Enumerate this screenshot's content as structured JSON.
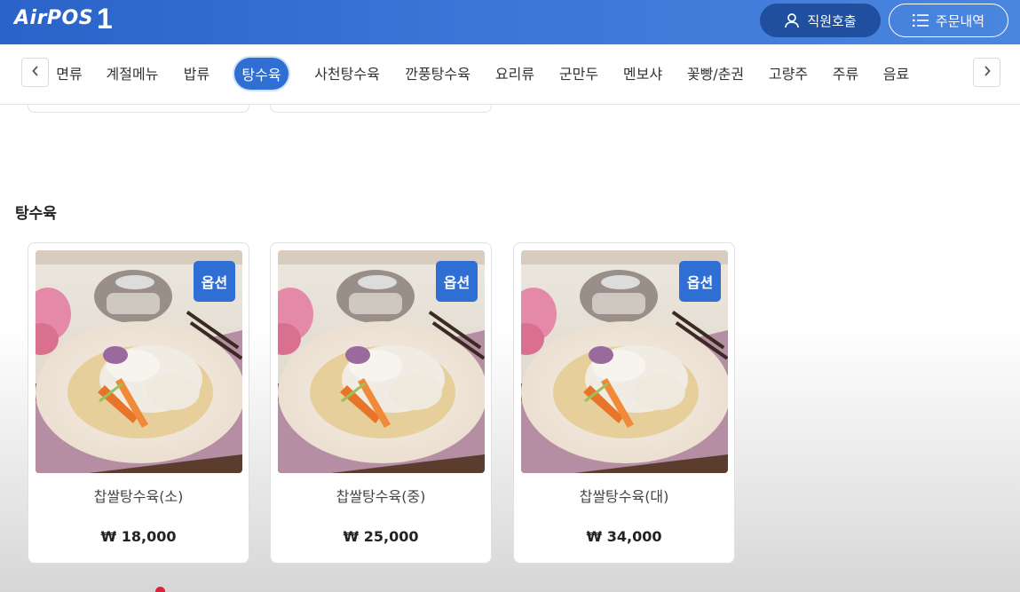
{
  "header": {
    "logo": "AirPOS",
    "table_number": "1",
    "staff_call_label": "직원호출",
    "order_history_label": "주문내역"
  },
  "categories": [
    {
      "label": "면류",
      "active": false
    },
    {
      "label": "계절메뉴",
      "active": false
    },
    {
      "label": "밥류",
      "active": false
    },
    {
      "label": "탕수육",
      "active": true
    },
    {
      "label": "사천탕수육",
      "active": false
    },
    {
      "label": "깐풍탕수육",
      "active": false
    },
    {
      "label": "요리류",
      "active": false
    },
    {
      "label": "군만두",
      "active": false
    },
    {
      "label": "멘보샤",
      "active": false
    },
    {
      "label": "꽃빵/춘권",
      "active": false
    },
    {
      "label": "고량주",
      "active": false
    },
    {
      "label": "주류",
      "active": false
    },
    {
      "label": "음료",
      "active": false
    }
  ],
  "section": {
    "title": "탕수육",
    "items": [
      {
        "name": "찹쌀탕수육(소)",
        "price": "₩ 18,000",
        "badge": "옵션"
      },
      {
        "name": "찹쌀탕수육(중)",
        "price": "₩ 25,000",
        "badge": "옵션"
      },
      {
        "name": "찹쌀탕수육(대)",
        "price": "₩ 34,000",
        "badge": "옵션"
      }
    ]
  },
  "colors": {
    "header_start": "#2a63c9",
    "header_end": "#4a86de",
    "accent": "#2f6ed3",
    "staff_button": "#1f4f9e",
    "indicator": "#e0203a"
  },
  "icons": {
    "staff_call": "person-icon",
    "order_history": "list-icon",
    "prev": "chevron-left-icon",
    "next": "chevron-right-icon"
  }
}
